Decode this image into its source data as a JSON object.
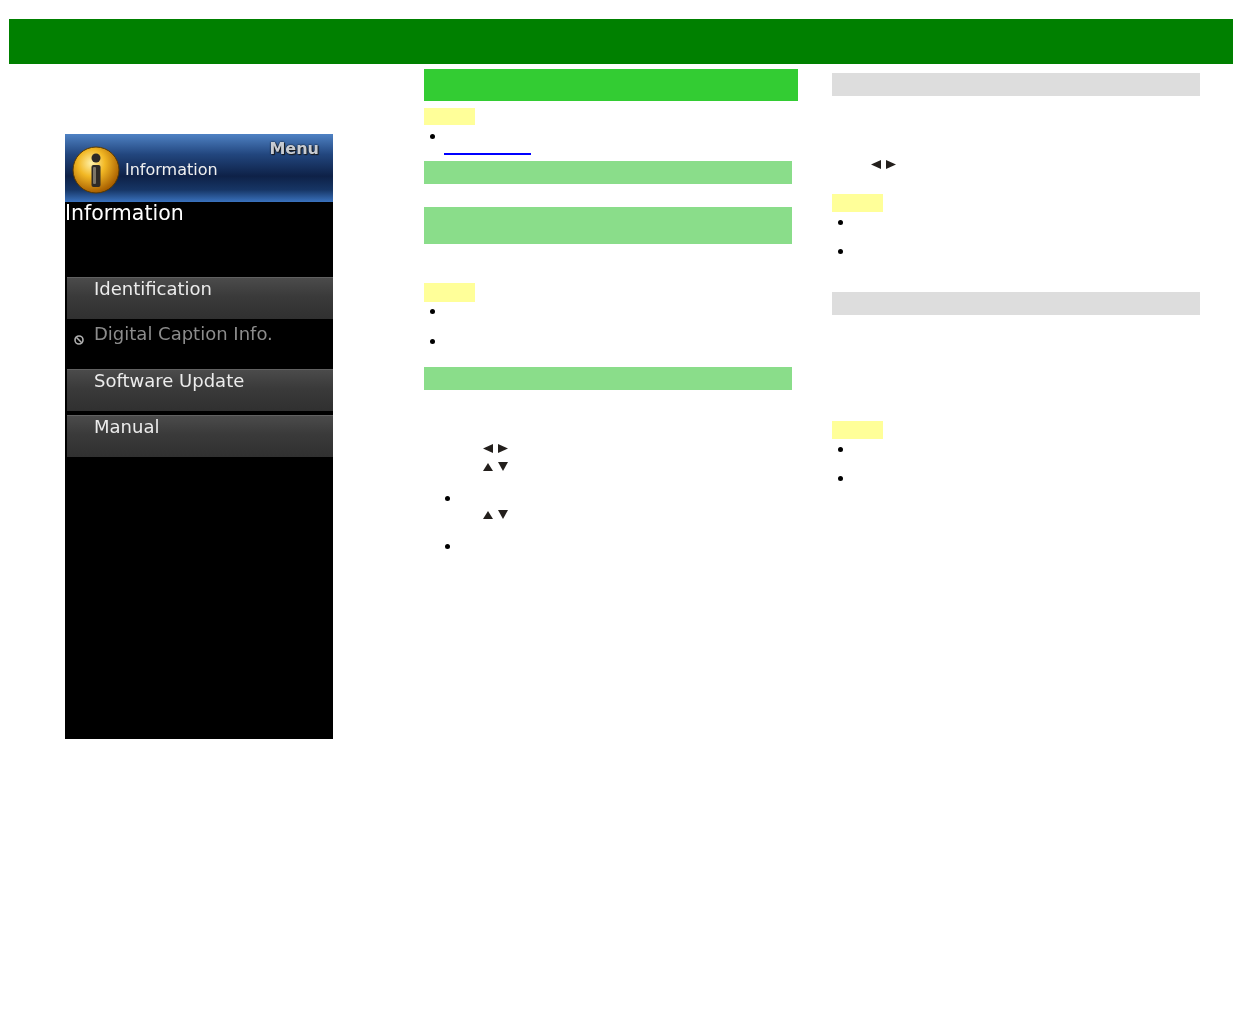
{
  "tv_menu": {
    "header_label": "Menu",
    "header_title": "Information",
    "title": "Information",
    "items": [
      {
        "label": "Identification",
        "disabled": false
      },
      {
        "label": "Digital Caption Info.",
        "disabled": true
      },
      {
        "label": "Software Update",
        "disabled": false
      },
      {
        "label": "Manual",
        "disabled": false
      }
    ]
  },
  "middle_column": [
    {
      "kind": "heading_bar"
    },
    {
      "kind": "note_tag"
    },
    {
      "kind": "bullet"
    },
    {
      "kind": "link"
    },
    {
      "kind": "section_bar"
    },
    {
      "kind": "section_bar"
    },
    {
      "kind": "note_tag"
    },
    {
      "kind": "bullet"
    },
    {
      "kind": "bullet"
    },
    {
      "kind": "section_bar"
    },
    {
      "kind": "keys_left_right"
    },
    {
      "kind": "keys_up_down"
    },
    {
      "kind": "bullet"
    },
    {
      "kind": "keys_up_down"
    },
    {
      "kind": "bullet"
    }
  ],
  "right_column": [
    {
      "kind": "subsection_bar"
    },
    {
      "kind": "keys_left_right"
    },
    {
      "kind": "note_tag"
    },
    {
      "kind": "bullet"
    },
    {
      "kind": "bullet"
    },
    {
      "kind": "subsection_bar"
    },
    {
      "kind": "note_tag"
    },
    {
      "kind": "bullet"
    },
    {
      "kind": "bullet"
    }
  ]
}
